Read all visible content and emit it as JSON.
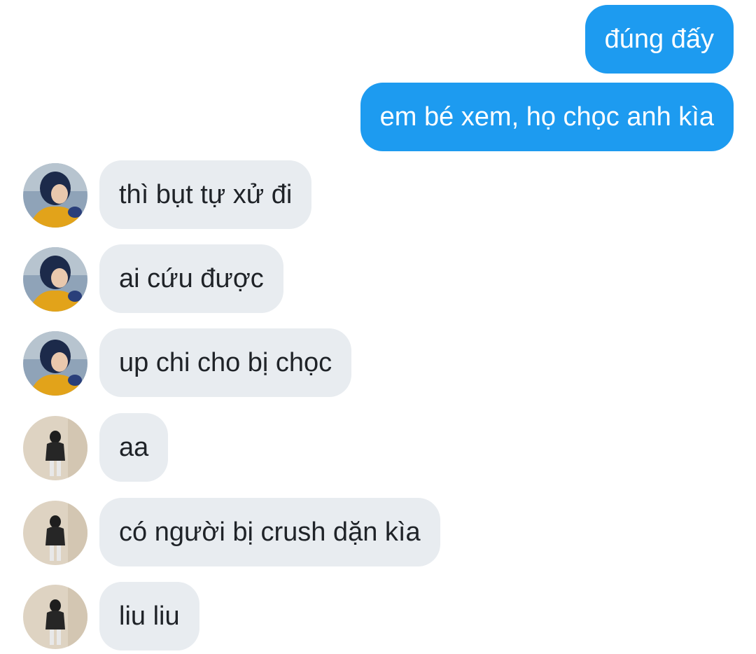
{
  "conversation": {
    "sent": [
      {
        "text": "đúng đấy"
      },
      {
        "text": "em bé xem, họ chọc anh kìa"
      }
    ],
    "received": [
      {
        "text": "thì bụt tự xử đi",
        "sender": "contact-a"
      },
      {
        "text": "ai cứu được",
        "sender": "contact-a"
      },
      {
        "text": "up chi cho bị chọc",
        "sender": "contact-a"
      },
      {
        "text": "aa",
        "sender": "contact-b"
      },
      {
        "text": "có người bị crush dặn kìa",
        "sender": "contact-b"
      },
      {
        "text": "liu liu",
        "sender": "contact-b"
      }
    ]
  },
  "colors": {
    "sent_bubble": "#1d9bf0",
    "received_bubble": "#e8ecf0",
    "background": "#ffffff"
  }
}
